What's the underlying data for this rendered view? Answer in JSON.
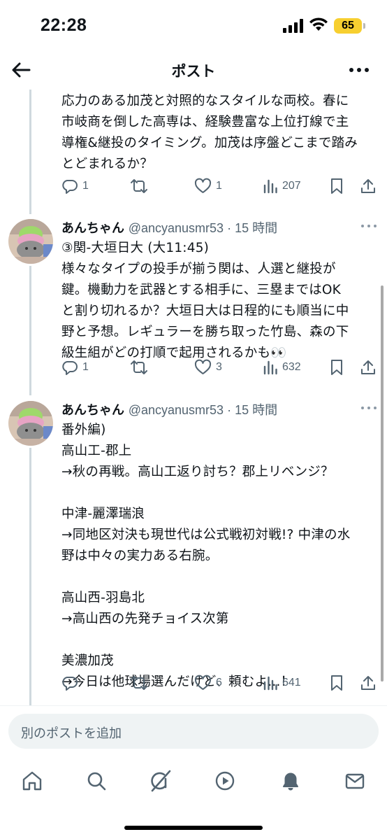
{
  "status_bar": {
    "time": "22:28",
    "battery": "65"
  },
  "header": {
    "title": "ポスト"
  },
  "posts": [
    {
      "text": "応力のある加茂と対照的なスタイルな両校。春に\n市岐商を倒した高専は、経験豊富な上位打線で主\n導権&継投のタイミング。加茂は序盤どこまで踏み\nとどまれるか？",
      "replies": "1",
      "retweets": "",
      "likes": "1",
      "views": "207"
    },
    {
      "name": "あんちゃん",
      "handle": "@ancyanusmr53 · 15 時間",
      "text": "③関-大垣日大 (大11:45)\n様々なタイプの投手が揃う関は、人選と継投が\n鍵。機動力を武器とする相手に、三塁まではOK\nと割り切れるか？大垣日大は日程的にも順当に中\n野と予想。レギュラーを勝ち取った竹島、森の下\n級生組がどの打順で起用されるかも👀",
      "replies": "1",
      "retweets": "",
      "likes": "3",
      "views": "632"
    },
    {
      "name": "あんちゃん",
      "handle": "@ancyanusmr53 · 15 時間",
      "text": "番外編)\n高山工-郡上\n→秋の再戦。高山工返り討ち？郡上リベンジ？\n\n中津-麗澤瑞浪\n→同地区対決も現世代は公式戦初対戦!? 中津の水\n野は中々の実力ある右腕。\n\n高山西-羽島北\n→高山西の先発チョイス次第\n\n美濃加茂\n→今日は他球場選んだけど、頼むよ...！",
      "replies": "",
      "retweets": "",
      "likes": "6",
      "views": "641"
    }
  ],
  "reply_box": {
    "placeholder": "別のポストを追加"
  },
  "tabs": [
    "home-icon",
    "search-icon",
    "grok-icon",
    "video-icon",
    "notifications-icon",
    "messages-icon"
  ],
  "colors": {
    "text": "#0f1419",
    "muted": "#536471",
    "thread_line": "#cfd9de",
    "battery": "#f7cf30"
  }
}
